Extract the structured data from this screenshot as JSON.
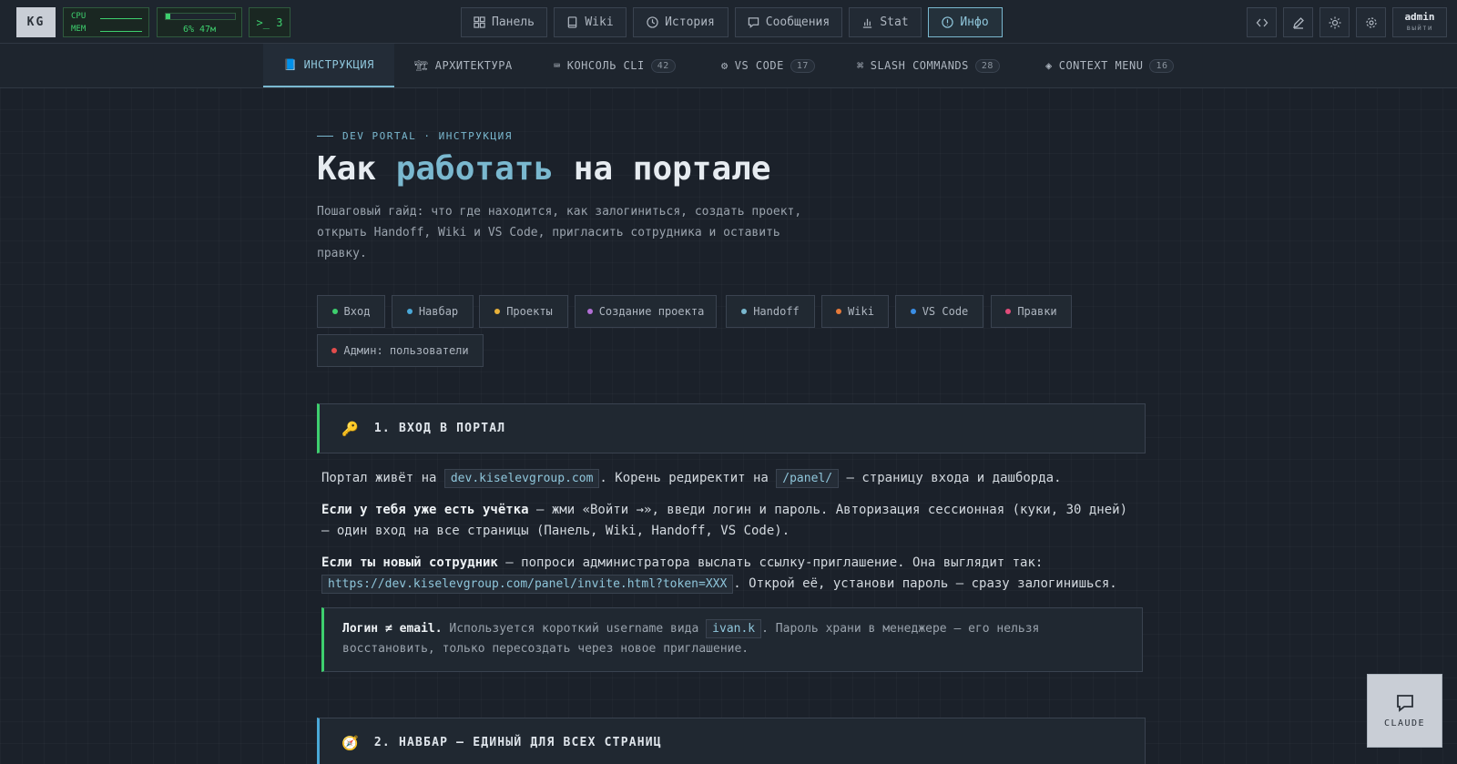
{
  "topbar": {
    "logo": "KG",
    "sys": {
      "cpu_label": "CPU",
      "mem_label": "MEM",
      "mem_value": "6% 47м",
      "mem_fill": 0.06,
      "terminal": ">_ 3"
    },
    "nav": [
      {
        "label": "Панель",
        "icon": "grid-icon"
      },
      {
        "label": "Wiki",
        "icon": "book-icon"
      },
      {
        "label": "История",
        "icon": "clock-icon"
      },
      {
        "label": "Сообщения",
        "icon": "message-icon"
      },
      {
        "label": "Stat",
        "icon": "bar-chart-icon"
      },
      {
        "label": "Инфо",
        "icon": "info-icon",
        "active": true
      }
    ],
    "user": {
      "name": "admin",
      "logout": "выйти"
    }
  },
  "tabs": [
    {
      "icon": "📘",
      "label": "ИНСТРУКЦИЯ",
      "active": true
    },
    {
      "icon": "🏗",
      "label": "АРХИТЕКТУРА"
    },
    {
      "icon": "⌨",
      "label": "КОНСОЛЬ CLI",
      "count": "42"
    },
    {
      "icon": "⚙",
      "label": "VS CODE",
      "count": "17"
    },
    {
      "icon": "⌘",
      "label": "SLASH COMMANDS",
      "count": "28"
    },
    {
      "icon": "◈",
      "label": "CONTEXT MENU",
      "count": "16"
    }
  ],
  "hero": {
    "kicker": "DEV PORTAL · ИНСТРУКЦИЯ",
    "title_part1": "Как ",
    "title_highlight": "работать",
    "title_part2": " на портале",
    "lead": "Пошаговый гайд: что где находится, как залогиниться, создать проект, открыть Handoff, Wiki и VS Code, пригласить сотрудника и оставить правку."
  },
  "chips": [
    {
      "label": "Вход",
      "color": "#3ecf6e"
    },
    {
      "label": "Навбар",
      "color": "#4aa8d8"
    },
    {
      "label": "Проекты",
      "color": "#e8b13a"
    },
    {
      "label": "Создание проекта",
      "color": "#b26fd6"
    },
    {
      "label": "Handoff",
      "color": "#7ab8cf"
    },
    {
      "label": "Wiki",
      "color": "#e67a3a"
    },
    {
      "label": "VS Code",
      "color": "#3a8ee6"
    },
    {
      "label": "Правки",
      "color": "#e24c7a"
    },
    {
      "label": "Админ: пользователи",
      "color": "#e24c4c"
    }
  ],
  "sections": [
    {
      "icon": "🔑",
      "title": "1. ВХОД В ПОРТАЛ",
      "accent": "#3ecf6e",
      "p1_a": "Портал живёт на ",
      "p1_code1": "dev.kiselevgroup.com",
      "p1_b": ". Корень редиректит на ",
      "p1_code2": "/panel/",
      "p1_c": " — страницу входа и дашборда.",
      "p2_bold": "Если у тебя уже есть учётка",
      "p2_rest": " — жми «Войти →», введи логин и пароль. Авторизация сессионная (куки, 30 дней) — один вход на все страницы (Панель, Wiki, Handoff, VS Code).",
      "p3_bold": "Если ты новый сотрудник",
      "p3_rest": " — попроси администратора выслать ссылку-приглашение. Она выглядит так:",
      "p3_code": "https://dev.kiselevgroup.com/panel/invite.html?token=XXX",
      "p3_after": ". Открой её, установи пароль — сразу залогинишься.",
      "note_bold": "Логин ≠ email.",
      "note_a": " Используется короткий username вида ",
      "note_code": "ivan.k",
      "note_b": ". Пароль храни в менеджере — его нельзя восстановить, только пересоздать через новое приглашение."
    },
    {
      "icon": "🧭",
      "title": "2. НАВБАР — ЕДИНЫЙ ДЛЯ ВСЕХ СТРАНИЦ",
      "accent": "#4aa8d8"
    }
  ],
  "fab": {
    "label": "CLAUDE"
  }
}
